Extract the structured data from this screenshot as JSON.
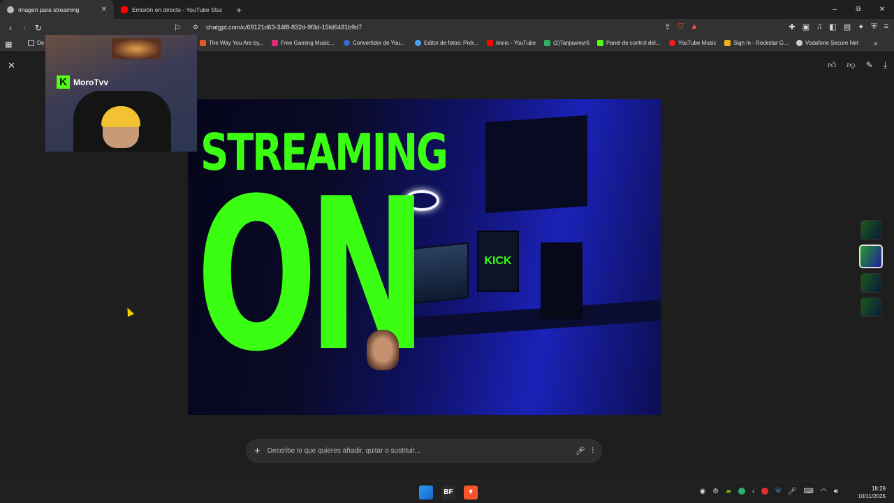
{
  "browser": {
    "tabs": [
      {
        "title": "Imagen para streaming",
        "active": true
      },
      {
        "title": "Emisión en directo - YouTube Studio",
        "active": false
      }
    ],
    "new_tab": "+",
    "window_controls": {
      "minimize": "–",
      "maximize": "⧉",
      "close": "✕"
    },
    "url": "chatgpt.com/c/69121d63-34f8-832d-9f3d-15fd6481b9d7",
    "bookmarks": [
      {
        "label": "De"
      },
      {
        "label": "The Way You Are by..."
      },
      {
        "label": "Free Gaming Music..."
      },
      {
        "label": "Convertidor de You..."
      },
      {
        "label": "Editor de fotos: Pixlr..."
      },
      {
        "label": "Inicio - YouTube"
      },
      {
        "label": "(2)Tanjawieyr6"
      },
      {
        "label": "Panel de control del..."
      },
      {
        "label": "YouTube Music"
      },
      {
        "label": "Sign In - Rockstar G..."
      },
      {
        "label": "Vodafone Secure Net"
      }
    ],
    "bookmarks_more": "»"
  },
  "webcam": {
    "platform_letter": "K",
    "streamer": "MoroTvv"
  },
  "image": {
    "headline_top": "STREAMING",
    "headline_big": "ON",
    "screen_text": "KICK"
  },
  "composer": {
    "plus": "+",
    "placeholder": "Describe lo que quieres añadir, quitar o sustituir..."
  },
  "taskbar": {
    "bf_label": "BF",
    "time": "18:29",
    "date": "10/11/2025"
  },
  "colors": {
    "accent_green": "#3aff12",
    "kick_green": "#53fc18",
    "bg": "#1e1e1e"
  }
}
